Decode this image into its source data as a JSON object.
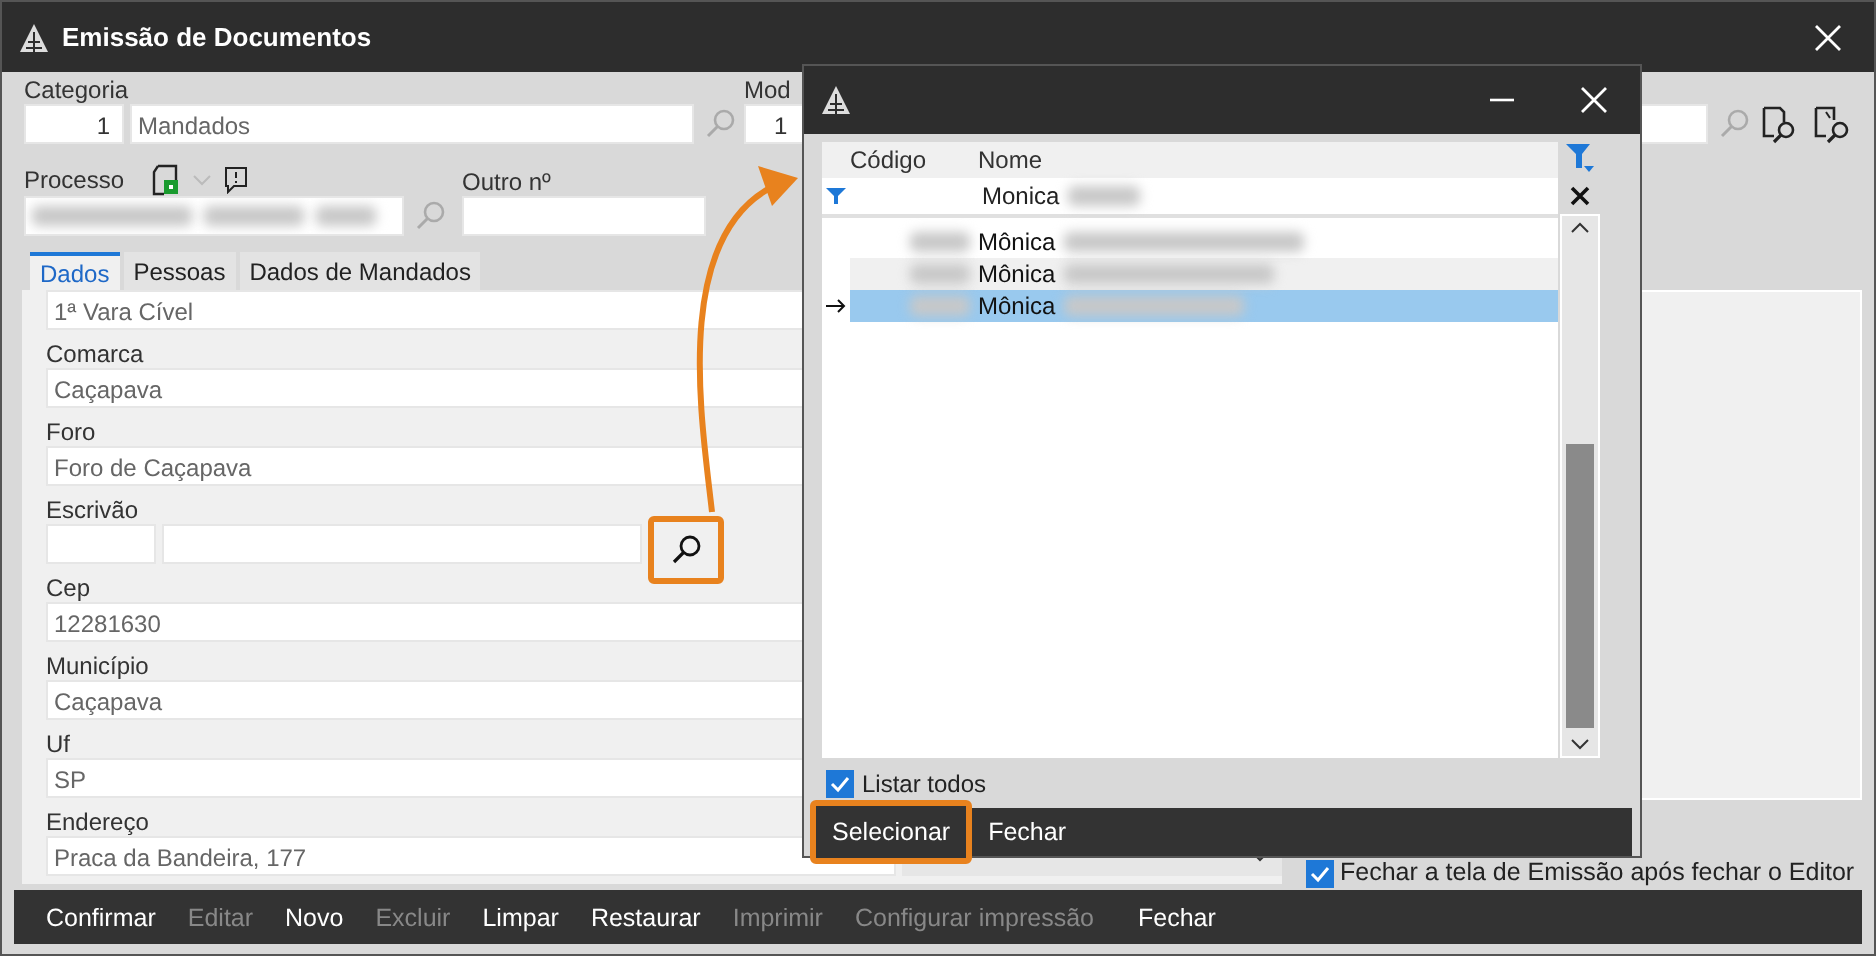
{
  "window": {
    "title": "Emissão de Documentos"
  },
  "categoria": {
    "label": "Categoria",
    "code": "1",
    "value": "Mandados"
  },
  "modelo": {
    "label": "Mod",
    "code": "1"
  },
  "processo": {
    "label": "Processo"
  },
  "outro_numero": {
    "label": "Outro nº"
  },
  "tabs": [
    {
      "label": "Dados",
      "selected": true
    },
    {
      "label": "Pessoas",
      "selected": false
    },
    {
      "label": "Dados de Mandados",
      "selected": false
    }
  ],
  "fields": [
    {
      "kind": "text",
      "value": "1ª Vara Cível"
    },
    {
      "kind": "text",
      "label": "Comarca",
      "value": "Caçapava"
    },
    {
      "kind": "text",
      "label": "Foro",
      "value": "Foro de Caçapava"
    },
    {
      "kind": "lookup",
      "label": "Escrivão",
      "highlighted": true
    },
    {
      "kind": "text",
      "label": "Cep",
      "value": "12281630"
    },
    {
      "kind": "text",
      "label": "Município",
      "value": "Caçapava"
    },
    {
      "kind": "text",
      "label": "Uf",
      "value": "SP"
    },
    {
      "kind": "combo",
      "label": "Endereço",
      "value": "Praca da Bandeira, 177"
    }
  ],
  "fechar_editor": {
    "label": "Fechar a tela de Emissão após fechar o Editor",
    "checked": true
  },
  "toolbar": [
    {
      "label": "Confirmar",
      "disabled": false
    },
    {
      "label": "Editar",
      "disabled": true
    },
    {
      "label": "Novo",
      "disabled": false
    },
    {
      "label": "Excluir",
      "disabled": true
    },
    {
      "label": "Limpar",
      "disabled": false
    },
    {
      "label": "Restaurar",
      "disabled": false
    },
    {
      "label": "Imprimir",
      "disabled": true
    },
    {
      "label": "Configurar impressão",
      "disabled": true
    },
    {
      "label": "Fechar",
      "disabled": false
    }
  ],
  "dialog": {
    "columns": [
      "Código",
      "Nome"
    ],
    "filter": "Monica",
    "rows": [
      {
        "name": "Mônica",
        "selected": false
      },
      {
        "name": "Mônica",
        "selected": false
      },
      {
        "name": "Mônica",
        "selected": true
      }
    ],
    "listar_todos": {
      "label": "Listar todos",
      "checked": true
    },
    "buttons": [
      {
        "label": "Selecionar",
        "highlighted": true
      },
      {
        "label": "Fechar",
        "highlighted": false
      }
    ]
  }
}
